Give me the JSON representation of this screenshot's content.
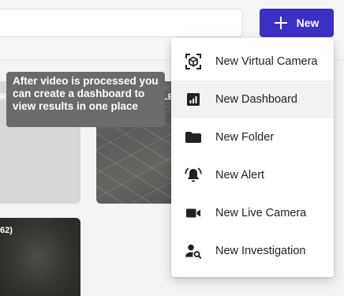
{
  "toolbar": {
    "new_label": "New",
    "new_icon": "plus-icon",
    "accent_color": "#3d2fc4"
  },
  "tooltip": {
    "text": "After video is processed you can create a dashboard to view results in one place"
  },
  "cards": [
    {
      "label": "R"
    },
    {
      "label": "LE"
    },
    {
      "label": "62)"
    }
  ],
  "menu": {
    "items": [
      {
        "label": "New Virtual Camera",
        "icon": "virtual-camera-icon"
      },
      {
        "label": "New Dashboard",
        "icon": "dashboard-icon",
        "highlighted": true
      },
      {
        "label": "New Folder",
        "icon": "folder-icon"
      },
      {
        "label": "New Alert",
        "icon": "bell-alert-icon"
      },
      {
        "label": "New Live Camera",
        "icon": "video-camera-icon"
      },
      {
        "label": "New Investigation",
        "icon": "person-search-icon"
      }
    ]
  }
}
